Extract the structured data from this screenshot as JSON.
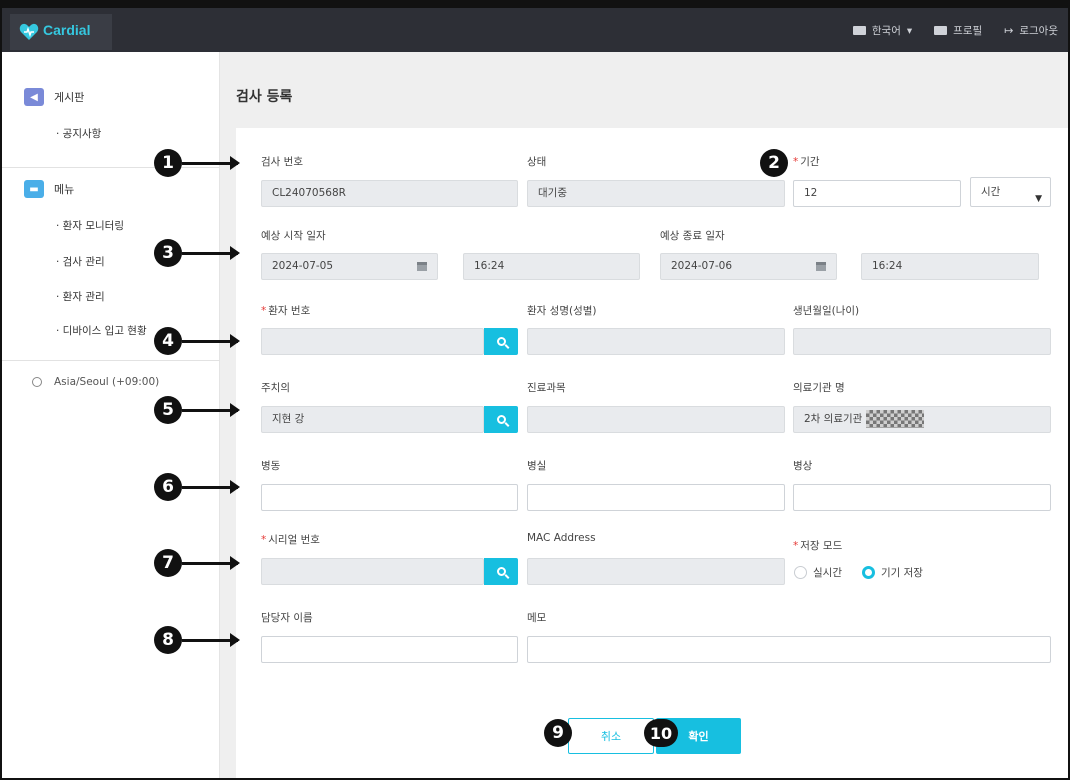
{
  "app": {
    "logo_text": "Cardial",
    "brand_color": "#17bfe0"
  },
  "topbar": {
    "language": "한국어",
    "profile": "프로필",
    "logout": "로그아웃"
  },
  "sidebar": {
    "board": {
      "label": "게시판",
      "icon": "megaphone-icon",
      "items": [
        "· 공지사항"
      ]
    },
    "menu": {
      "label": "메뉴",
      "icon": "folder-icon",
      "items": [
        "· 환자 모니터링",
        "· 검사 관리",
        "· 환자 관리",
        "· 디바이스 입고 현황"
      ]
    },
    "timezone": "Asia/Seoul (+09:00)"
  },
  "page": {
    "title": "검사 등록"
  },
  "form": {
    "exam_no": {
      "label": "검사 번호",
      "value": "CL24070568R"
    },
    "status": {
      "label": "상태",
      "value": "대기중"
    },
    "duration": {
      "label": "기간",
      "value": "12",
      "unit": "시간"
    },
    "start": {
      "label": "예상 시작 일자",
      "date": "2024-07-05",
      "time": "16:24"
    },
    "end": {
      "label": "예상 종료 일자",
      "date": "2024-07-06",
      "time": "16:24"
    },
    "patient_no": {
      "label": "환자 번호",
      "value": ""
    },
    "patient_name": {
      "label": "환자 성명(성별)",
      "value": ""
    },
    "birth": {
      "label": "생년월일(나이)",
      "value": ""
    },
    "doctor": {
      "label": "주치의",
      "value": "지현 강"
    },
    "department": {
      "label": "진료과목",
      "value": ""
    },
    "institution": {
      "label": "의료기관 명",
      "value": "2차 의료기관"
    },
    "ward": {
      "label": "병동",
      "value": ""
    },
    "room": {
      "label": "병실",
      "value": ""
    },
    "bed": {
      "label": "병상",
      "value": ""
    },
    "serial": {
      "label": "시리얼 번호",
      "value": ""
    },
    "mac": {
      "label": "MAC Address",
      "value": ""
    },
    "save_mode": {
      "label": "저장 모드",
      "options": [
        "실시간",
        "기기 저장"
      ],
      "selected": "기기 저장"
    },
    "manager": {
      "label": "담당자 이름",
      "value": ""
    },
    "memo": {
      "label": "메모",
      "value": ""
    }
  },
  "buttons": {
    "cancel": "취소",
    "confirm": "확인"
  },
  "annotations": [
    "1",
    "2",
    "3",
    "4",
    "5",
    "6",
    "7",
    "8",
    "9",
    "10"
  ]
}
